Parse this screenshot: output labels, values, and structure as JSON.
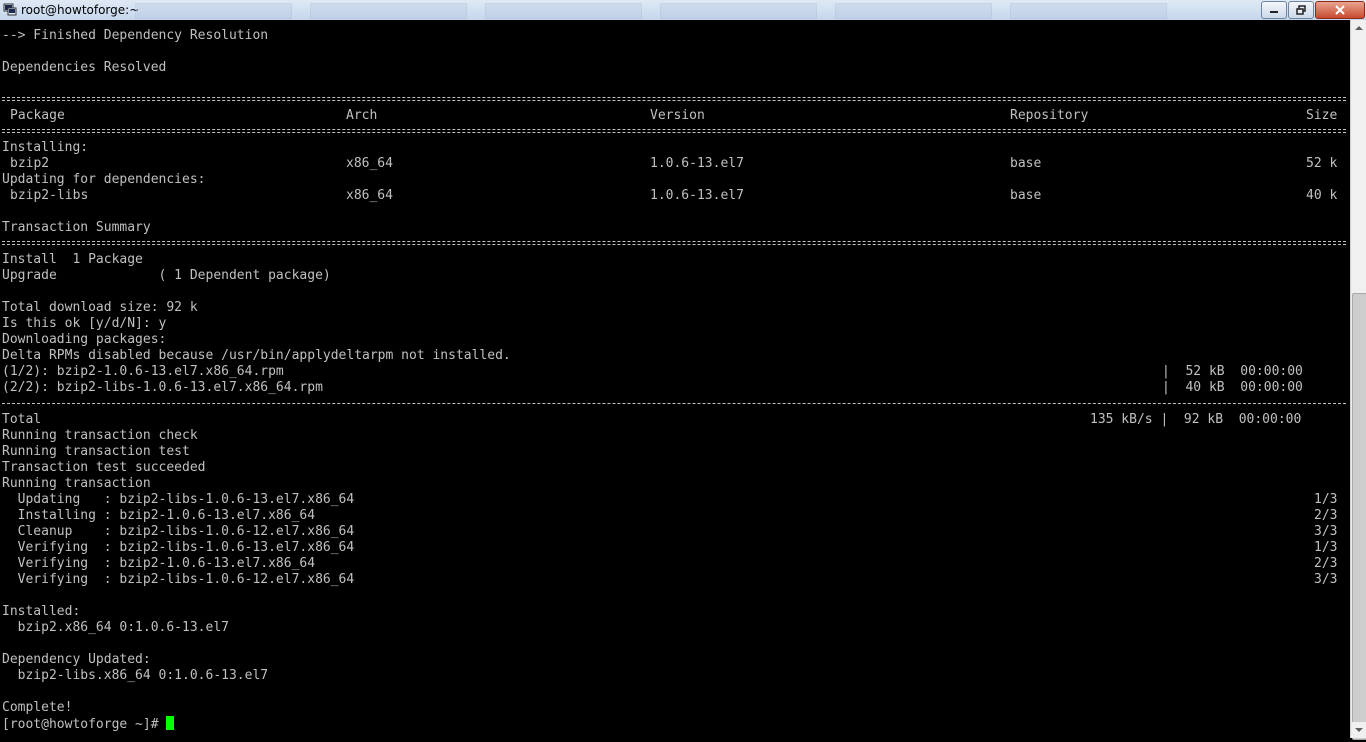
{
  "window": {
    "title": "root@howtoforge:~"
  },
  "terminal": {
    "l_finished": "--> Finished Dependency Resolution",
    "l_resolved": "Dependencies Resolved",
    "h_package": "Package",
    "h_arch": "Arch",
    "h_version": "Version",
    "h_repository": "Repository",
    "h_size": "Size",
    "l_installing": "Installing:",
    "r1_pkg": "bzip2",
    "r1_arch": "x86_64",
    "r1_ver": "1.0.6-13.el7",
    "r1_repo": "base",
    "r1_size": "52 k",
    "l_updating_deps": "Updating for dependencies:",
    "r2_pkg": "bzip2-libs",
    "r2_arch": "x86_64",
    "r2_ver": "1.0.6-13.el7",
    "r2_repo": "base",
    "r2_size": "40 k",
    "l_txn_summary": "Transaction Summary",
    "l_install": "Install  1 Package",
    "l_upgrade": "Upgrade             ( 1 Dependent package)",
    "l_total_dl": "Total download size: 92 k",
    "l_is_ok": "Is this ok [y/d/N]: y",
    "l_downloading": "Downloading packages:",
    "l_delta": "Delta RPMs disabled because /usr/bin/applydeltarpm not installed.",
    "dl1_name": "(1/2): bzip2-1.0.6-13.el7.x86_64.rpm",
    "dl1_stat": "|  52 kB  00:00:00",
    "dl2_name": "(2/2): bzip2-libs-1.0.6-13.el7.x86_64.rpm",
    "dl2_stat": "|  40 kB  00:00:00",
    "l_total": "Total",
    "total_stat": "135 kB/s |  92 kB  00:00:00",
    "l_check": "Running transaction check",
    "l_test": "Running transaction test",
    "l_succeeded": "Transaction test succeeded",
    "l_running": "Running transaction",
    "s1": "  Updating   : bzip2-libs-1.0.6-13.el7.x86_64",
    "s1_p": "1/3",
    "s2": "  Installing : bzip2-1.0.6-13.el7.x86_64",
    "s2_p": "2/3",
    "s3": "  Cleanup    : bzip2-libs-1.0.6-12.el7.x86_64",
    "s3_p": "3/3",
    "s4": "  Verifying  : bzip2-libs-1.0.6-13.el7.x86_64",
    "s4_p": "1/3",
    "s5": "  Verifying  : bzip2-1.0.6-13.el7.x86_64",
    "s5_p": "2/3",
    "s6": "  Verifying  : bzip2-libs-1.0.6-12.el7.x86_64",
    "s6_p": "3/3",
    "l_installed": "Installed:",
    "l_installed_pkg": "  bzip2.x86_64 0:1.0.6-13.el7",
    "l_dep_updated": "Dependency Updated:",
    "l_dep_pkg": "  bzip2-libs.x86_64 0:1.0.6-13.el7",
    "l_complete": "Complete!",
    "prompt": "[root@howtoforge ~]# "
  },
  "colors": {
    "text": "#c0c0c0",
    "background": "#000000",
    "cursor": "#00ff00"
  },
  "icons": {
    "app": "putty-terminal-icon"
  }
}
